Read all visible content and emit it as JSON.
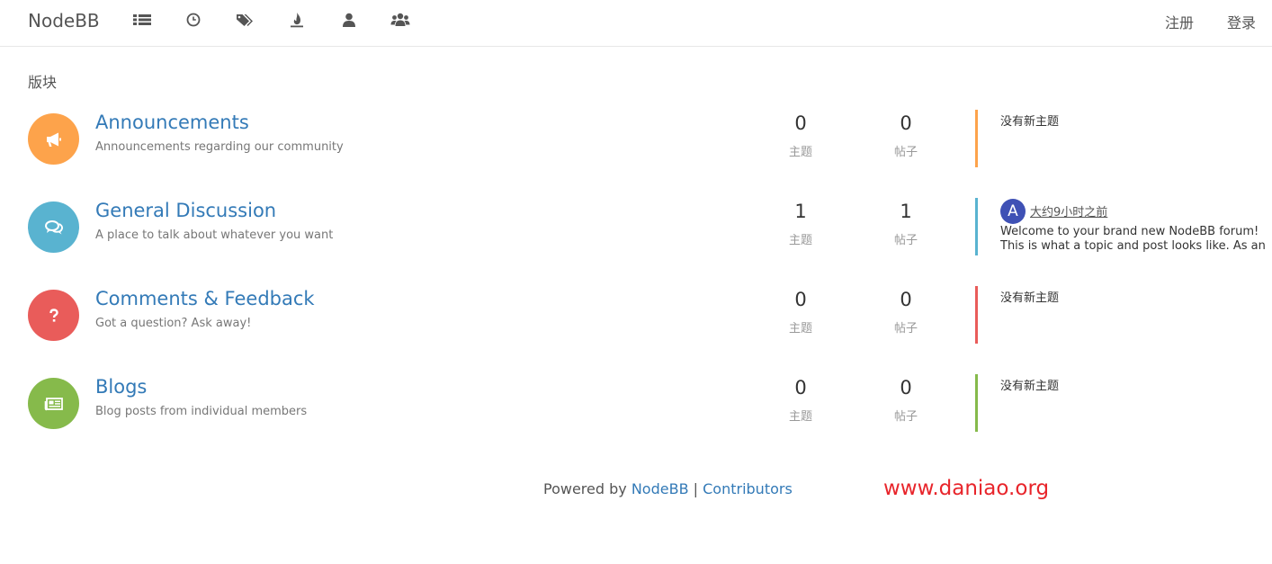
{
  "navbar": {
    "brand": "NodeBB",
    "icons": [
      "categories-icon",
      "recent-icon",
      "tags-icon",
      "popular-icon",
      "users-icon",
      "groups-icon"
    ],
    "register_label": "注册",
    "login_label": "登录"
  },
  "page": {
    "section_title": "版块"
  },
  "categories": [
    {
      "name": "Announcements",
      "description": "Announcements regarding our community",
      "icon": "bullhorn-icon",
      "color": "#fda34b",
      "topics": "0",
      "posts": "0",
      "topics_label": "主题",
      "posts_label": "帖子",
      "teaser_empty": "没有新主题"
    },
    {
      "name": "General Discussion",
      "description": "A place to talk about whatever you want",
      "icon": "comments-icon",
      "color": "#59b3d0",
      "topics": "1",
      "posts": "1",
      "topics_label": "主题",
      "posts_label": "帖子",
      "teaser": {
        "avatar_letter": "A",
        "avatar_color": "#3f51b5",
        "time": "大约9小时之前",
        "content": "Welcome to your brand new NodeBB forum!\nThis is what a topic and post looks like. As an"
      }
    },
    {
      "name": "Comments & Feedback",
      "description": "Got a question? Ask away!",
      "icon": "question-icon",
      "color": "#e95c5a",
      "topics": "0",
      "posts": "0",
      "topics_label": "主题",
      "posts_label": "帖子",
      "teaser_empty": "没有新主题"
    },
    {
      "name": "Blogs",
      "description": "Blog posts from individual members",
      "icon": "newspaper-icon",
      "color": "#86ba4b",
      "topics": "0",
      "posts": "0",
      "topics_label": "主题",
      "posts_label": "帖子",
      "teaser_empty": "没有新主题"
    }
  ],
  "footer": {
    "powered_by": "Powered by",
    "nodebb_link": "NodeBB",
    "separator": "|",
    "contributors_link": "Contributors"
  },
  "watermark": "www.daniao.org"
}
